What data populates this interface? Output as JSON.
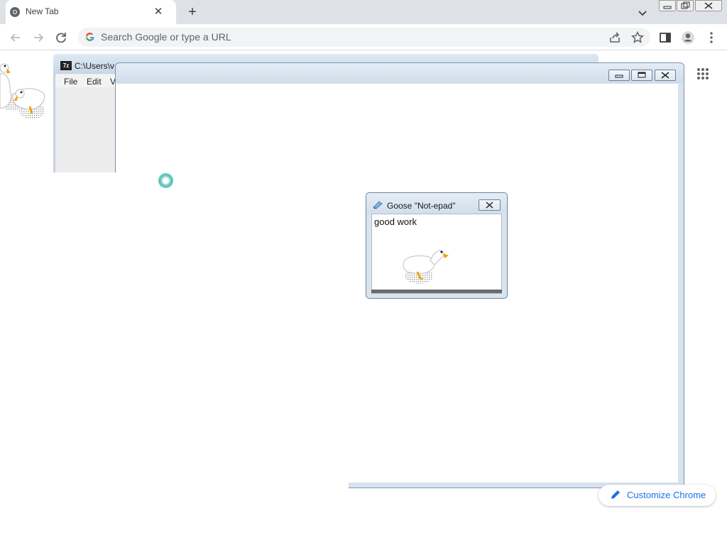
{
  "browser": {
    "tab_title": "New Tab",
    "tab_close": "✕",
    "new_tab": "+",
    "omnibox_placeholder": "Search Google or type a URL",
    "customize_label": "Customize Chrome"
  },
  "window_7zip": {
    "caption": "C:\\Users\\v",
    "icon_label": "7z",
    "menu": [
      "File",
      "Edit",
      "V"
    ]
  },
  "notepad": {
    "caption": "Goose \"Not-epad\"",
    "body_text": "good work"
  },
  "colors": {
    "accent": "#1a73e8",
    "chrome_tabstrip": "#dee1e6",
    "window_frame": "#d7e3ee",
    "goose_beak": "#f4a300"
  }
}
